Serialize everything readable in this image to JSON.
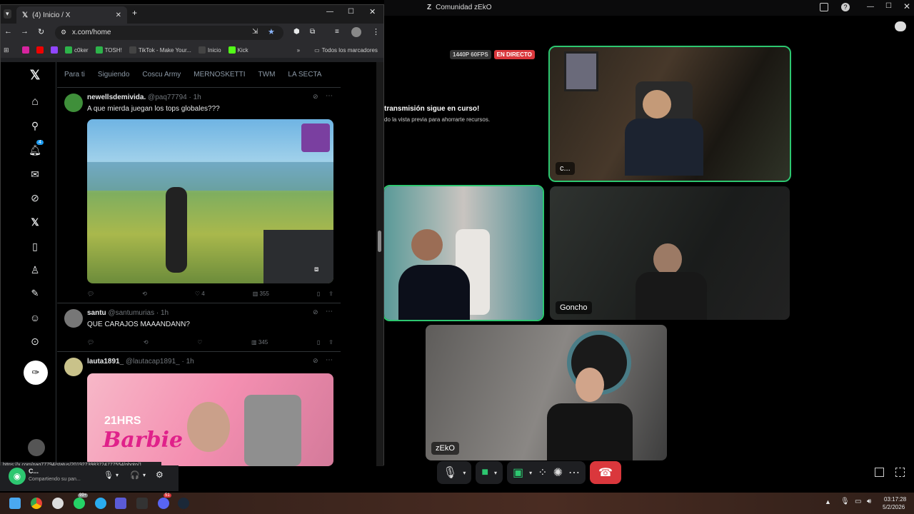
{
  "browser": {
    "tab_title": "(4) Inicio / X",
    "url": "x.com/home",
    "bookmarks": [
      {
        "label": "c0ker",
        "color": "#2db34a"
      },
      {
        "label": "TOSH!",
        "color": "#2db34a"
      },
      {
        "label": "TikTok - Make Your...",
        "color": "#111"
      },
      {
        "label": "Inicio",
        "color": "#111"
      },
      {
        "label": "Kick",
        "color": "#53fc18"
      }
    ],
    "bookmarks_folder": "Todos los marcadores",
    "status_url": "https://x.com/paq77794/status/2019273983724777554/photo/1"
  },
  "x": {
    "tabs": [
      "Para ti",
      "Siguiendo",
      "Coscu Army",
      "MERNOSKETTI",
      "TWM",
      "LA SECTA"
    ],
    "notification_badge": "4",
    "tweets": [
      {
        "name": "newellsdemivida.",
        "handle": "@paq77794 · 1h",
        "text": "A que mierda juegan los tops globales???",
        "likes": "4",
        "views": "355",
        "avatar": "#3f8f3a"
      },
      {
        "name": "santu",
        "handle": "@santumurias · 1h",
        "text": "QUE CARAJOS MAAANDANN?",
        "likes": "",
        "views": "345",
        "avatar": "#777"
      },
      {
        "name": "lauta1891_",
        "handle": "@lautacap1891_ · 1h",
        "text": "",
        "likes": "",
        "views": "",
        "avatar": "#c9c28a"
      }
    ],
    "media3_text_top": "21HRS",
    "media3_text_main": "Barbie"
  },
  "discord": {
    "window_title": "Comunidad zEkO",
    "stream_quality": "1440P 60FPS",
    "live_badge": "EN DIRECTO",
    "preview_title": "transmisión sigue en curso!",
    "preview_sub": "do la vista previa para ahorrarte recursos.",
    "tiles": [
      {
        "name": "c..."
      },
      {
        "name": ""
      },
      {
        "name": "Goncho"
      },
      {
        "name": "zEkO"
      }
    ],
    "panel_user": "C...",
    "panel_status": "Compartiendo su pan..."
  },
  "taskbar": {
    "time": "03:17:28",
    "date": "5/2/2026",
    "badge_whatsapp": "99+",
    "badge_discord": "51"
  }
}
